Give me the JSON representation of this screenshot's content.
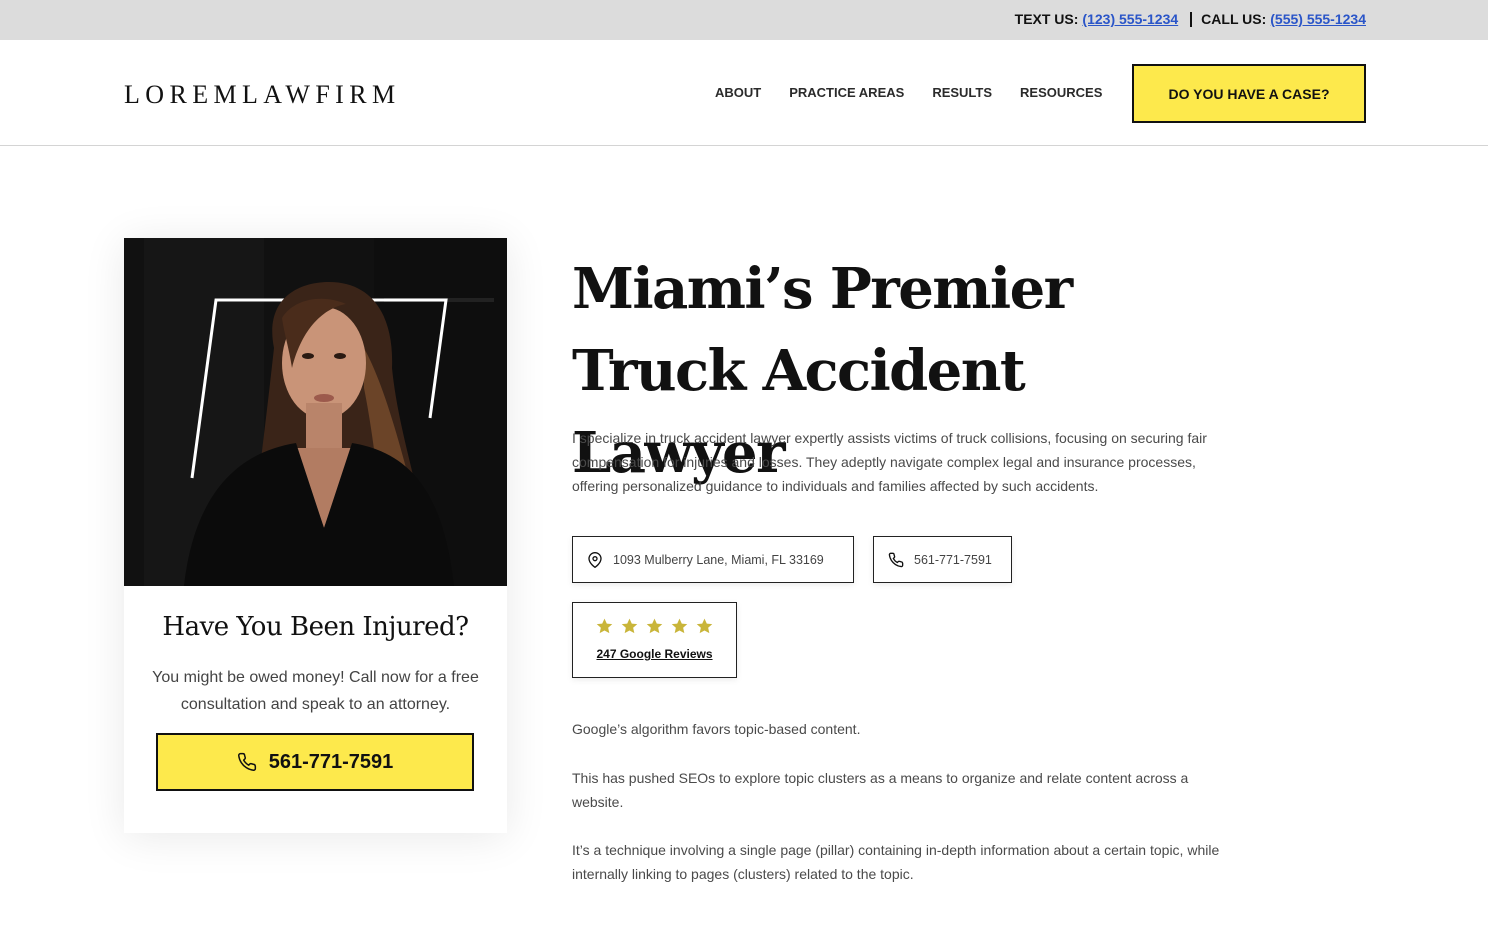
{
  "topbar": {
    "text_label": "TEXT US:",
    "text_number": "(123) 555-1234",
    "call_label": "CALL US:",
    "call_number": "(555) 555-1234"
  },
  "header": {
    "logo": "LOREMLAWFIRM",
    "nav": [
      "ABOUT",
      "PRACTICE AREAS",
      "RESULTS",
      "RESOURCES"
    ],
    "cta_label": "DO YOU HAVE A CASE?"
  },
  "card": {
    "title": "Have You Been Injured?",
    "text": "You might be owed money! Call now for a free consultation and speak to an attorney.",
    "phone": "561-771-7591"
  },
  "hero": {
    "title": "Miami’s Premier Truck Accident Lawyer",
    "description": "I specialize in truck accident lawyer expertly assists victims of truck collisions, focusing on securing fair compensation for injuries and losses. They adeptly navigate complex legal and insurance processes, offering personalized guidance to individuals and families affected by such accidents."
  },
  "contact": {
    "address": "1093 Mulberry Lane, Miami, FL  33169",
    "phone": "561-771-7591"
  },
  "reviews": {
    "stars": 5,
    "label": "247 Google Reviews"
  },
  "content": {
    "paragraphs": [
      "Google’s algorithm favors topic-based content.",
      "This has pushed SEOs to explore topic clusters as a means to organize and relate content across a website.",
      "It’s a technique involving a single page (pillar) containing in-depth information about a certain topic, while internally linking to pages (clusters) related to the topic."
    ]
  },
  "colors": {
    "accent_yellow": "#fde94c",
    "star_gold": "#c9b53a",
    "link_blue": "#2a55c8",
    "topbar_gray": "#dcdcdc"
  },
  "icons": {
    "location": "map-pin-icon",
    "phone": "phone-icon",
    "star": "star-icon"
  }
}
